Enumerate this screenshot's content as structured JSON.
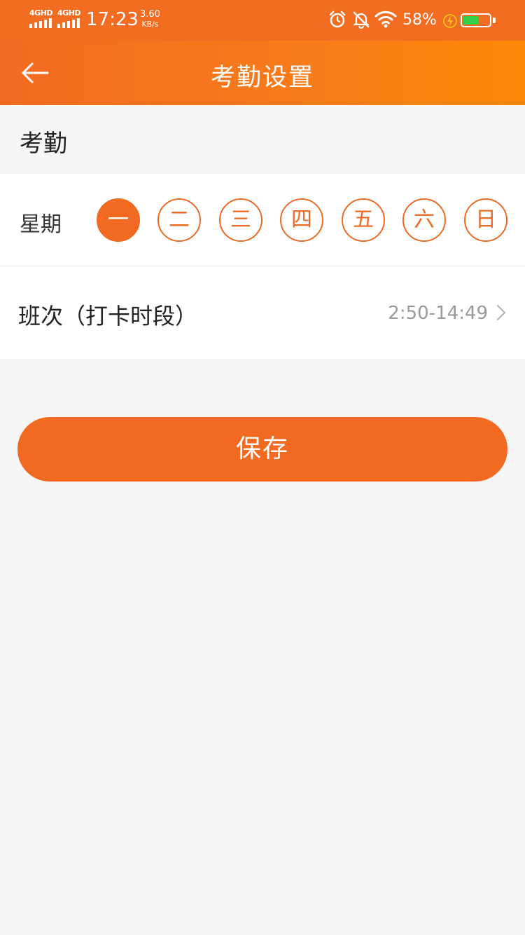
{
  "status_bar": {
    "network_1": "4GHD",
    "network_2": "4GHD",
    "time": "17:23",
    "speed_value": "3.60",
    "speed_unit": "KB/s",
    "battery_percent": "58%",
    "battery_level": 0.58,
    "battery_color": "#35d04a",
    "icons": [
      "alarm-icon",
      "bell-off-icon",
      "wifi-icon",
      "charging-icon"
    ]
  },
  "nav": {
    "back_icon": "arrow-left-icon",
    "title": "考勤设置"
  },
  "section": {
    "title": "考勤"
  },
  "week": {
    "label": "星期",
    "days": [
      {
        "label": "一",
        "selected": true
      },
      {
        "label": "二",
        "selected": false
      },
      {
        "label": "三",
        "selected": false
      },
      {
        "label": "四",
        "selected": false
      },
      {
        "label": "五",
        "selected": false
      },
      {
        "label": "六",
        "selected": false
      },
      {
        "label": "日",
        "selected": false
      }
    ]
  },
  "shift": {
    "label": "班次（打卡时段）",
    "value": "2:50-14:49",
    "chevron_icon": "chevron-right-icon"
  },
  "actions": {
    "save_label": "保存"
  },
  "colors": {
    "accent": "#f26a22",
    "background": "#f5f5f5"
  }
}
